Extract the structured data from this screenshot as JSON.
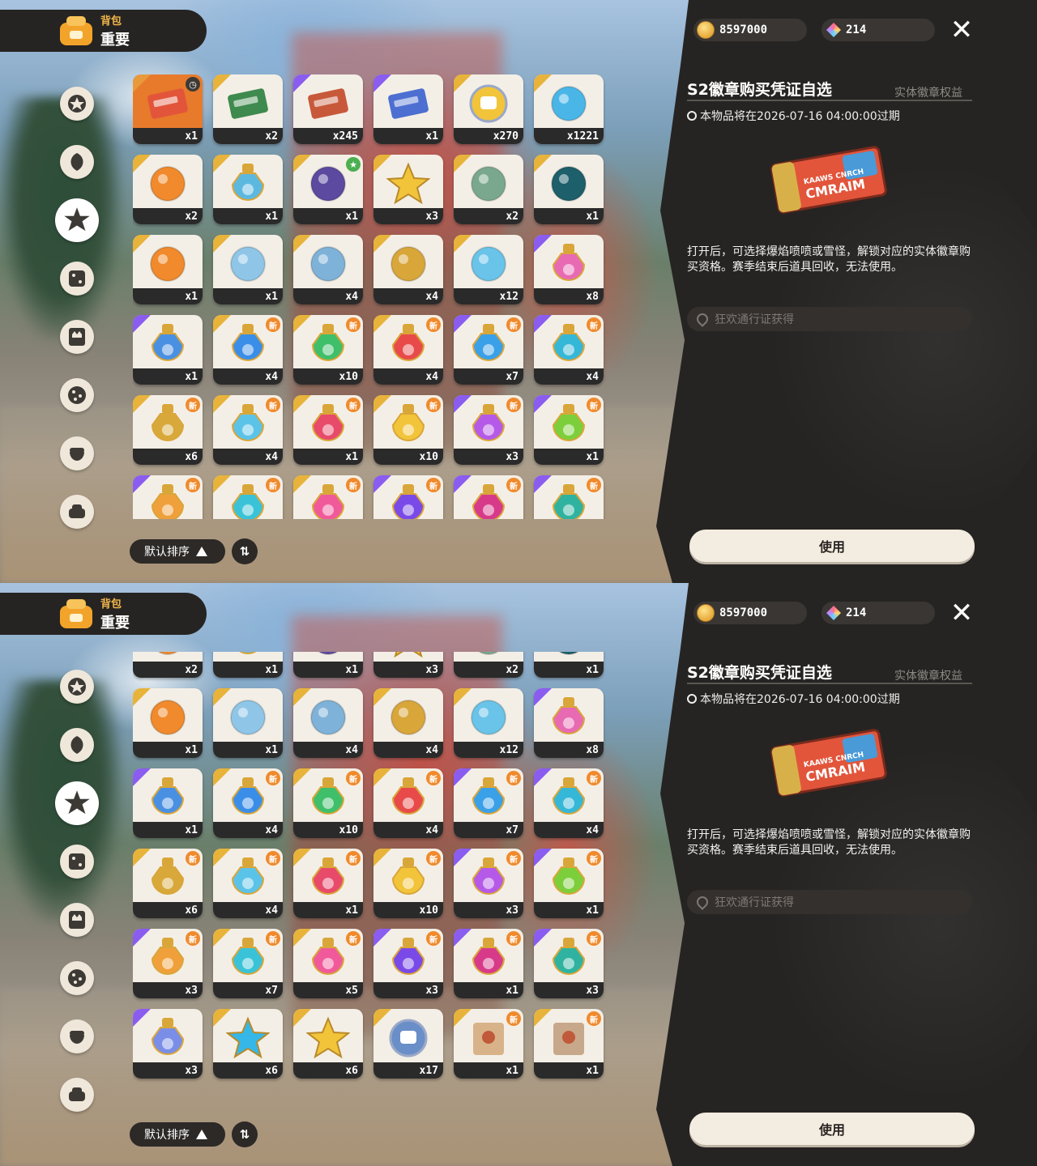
{
  "inventory": {
    "title_small": "背包",
    "title_main": "重要",
    "sort_label": "默认排序",
    "sort_toggle_icon": "⇅"
  },
  "currency": {
    "coins": "8597000",
    "gems": "214"
  },
  "categories": [
    "star-badge-icon",
    "leaf-swirl-icon",
    "starburst-icon",
    "dice-icon",
    "crown-card-icon",
    "dots-ball-icon",
    "acorn-icon",
    "sofa-icon"
  ],
  "detail": {
    "title": "S2徽章购买凭证自选",
    "tag": "实体徽章权益",
    "expire": "本物品将在2026-07-16 04:00:00过期",
    "description": "打开后，可选择爆焰喷喷或雪怪，解锁对应的实体徽章购买资格。赛季结束后道具回收，无法使用。",
    "source": "狂欢通行证获得",
    "use_label": "使用",
    "ticket_text_small": "KAAWS CNRCH",
    "ticket_text_main": "CMRAIM"
  },
  "items": [
    {
      "icon": "ticket-icon",
      "qty": "x1",
      "tier": "#e89a3a",
      "mark": "time",
      "color": "#e2553b"
    },
    {
      "icon": "green-ticket-icon",
      "qty": "x2",
      "tier": "#e8b33a",
      "color": "#3f8a4e"
    },
    {
      "icon": "bunny-ticket-icon",
      "qty": "x245",
      "tier": "#8a5cf0",
      "color": "#c7593a"
    },
    {
      "icon": "card-icon",
      "qty": "x1",
      "tier": "#8a5cf0",
      "color": "#4c6fd1"
    },
    {
      "icon": "camera-coin-icon",
      "qty": "x270",
      "tier": "#e8b33a",
      "color": "#f2c43a"
    },
    {
      "icon": "crystal-icon",
      "qty": "x1221",
      "tier": "#e8b33a",
      "color": "#4ab6e8"
    },
    {
      "icon": "orange-star-emblem-icon",
      "qty": "x2",
      "tier": "#e8b33a",
      "color": "#f08a2c"
    },
    {
      "icon": "blue-swirl-bottle-icon",
      "qty": "x1",
      "tier": "#e8b33a",
      "color": "#5db8e0"
    },
    {
      "icon": "purple-pouch-icon",
      "qty": "x1",
      "tier": "#e8b33a",
      "mark": "green",
      "color": "#5b4aa0"
    },
    {
      "icon": "gold-star-icon",
      "qty": "x3",
      "tier": "#e8b33a",
      "color": "#f2c43a"
    },
    {
      "icon": "crown-icon",
      "qty": "x2",
      "tier": "#e8b33a",
      "color": "#7aa88e"
    },
    {
      "icon": "teal-leaf-icon",
      "qty": "x1",
      "tier": "#e8b33a",
      "color": "#1d5f6a"
    },
    {
      "icon": "fire-flower-icon",
      "qty": "x1",
      "tier": "#e8b33a",
      "color": "#f08a2c"
    },
    {
      "icon": "mirror-icon",
      "qty": "x1",
      "tier": "#e8b33a",
      "color": "#8fc6e8"
    },
    {
      "icon": "shell-icon",
      "qty": "x4",
      "tier": "#e8b33a",
      "color": "#7fb2d8"
    },
    {
      "icon": "key-icon",
      "qty": "x4",
      "tier": "#e8b33a",
      "color": "#d9a63a"
    },
    {
      "icon": "wand-icon",
      "qty": "x12",
      "tier": "#e8b33a",
      "color": "#6ac3e8"
    },
    {
      "icon": "rainbow-bottle-icon",
      "qty": "x8",
      "tier": "#8a5cf0",
      "color": "#e86ab3"
    },
    {
      "icon": "blue-potion-icon",
      "qty": "x1",
      "tier": "#8a5cf0",
      "color": "#4a90e2"
    },
    {
      "icon": "blue-star-potion-icon",
      "qty": "x4",
      "tier": "#e8b33a",
      "new": true,
      "color": "#3a8ee8"
    },
    {
      "icon": "green-potion-icon",
      "qty": "x10",
      "tier": "#e8b33a",
      "new": true,
      "color": "#3fbf6a"
    },
    {
      "icon": "red-potion-icon",
      "qty": "x4",
      "tier": "#e8b33a",
      "new": true,
      "color": "#e84a4a"
    },
    {
      "icon": "blue-drop-potion-icon",
      "qty": "x7",
      "tier": "#8a5cf0",
      "new": true,
      "color": "#3aa0e8"
    },
    {
      "icon": "teal-star-potion-icon",
      "qty": "x4",
      "tier": "#8a5cf0",
      "new": true,
      "color": "#35b7d8"
    },
    {
      "icon": "gold-potion-icon",
      "qty": "x6",
      "tier": "#e8b33a",
      "new": true,
      "color": "#d8a83a"
    },
    {
      "icon": "sky-potion-icon",
      "qty": "x4",
      "tier": "#e8b33a",
      "new": true,
      "color": "#5cc3e8"
    },
    {
      "icon": "heart-potion-icon",
      "qty": "x1",
      "tier": "#e8b33a",
      "new": true,
      "color": "#e84a6a"
    },
    {
      "icon": "yellow-potion-icon",
      "qty": "x10",
      "tier": "#e8b33a",
      "new": true,
      "color": "#f2c43a"
    },
    {
      "icon": "violet-potion-icon",
      "qty": "x3",
      "tier": "#8a5cf0",
      "new": true,
      "color": "#b55ae8"
    },
    {
      "icon": "lime-potion-icon",
      "qty": "x1",
      "tier": "#8a5cf0",
      "new": true,
      "color": "#7ccf3a"
    },
    {
      "icon": "orange-potion-icon",
      "qty": "x3",
      "tier": "#8a5cf0",
      "new": true,
      "color": "#f0a03a"
    },
    {
      "icon": "cyan-potion-icon",
      "qty": "x7",
      "tier": "#e8b33a",
      "new": true,
      "color": "#3ac3d8"
    },
    {
      "icon": "pink-potion-icon",
      "qty": "x5",
      "tier": "#e8b33a",
      "new": true,
      "color": "#f05a9a"
    },
    {
      "icon": "purple-potion-icon",
      "qty": "x3",
      "tier": "#8a5cf0",
      "new": true,
      "color": "#7a4ae8"
    },
    {
      "icon": "magenta-potion-icon",
      "qty": "x1",
      "tier": "#8a5cf0",
      "new": true,
      "color": "#d83a8a"
    },
    {
      "icon": "teal-potion-icon",
      "qty": "x3",
      "tier": "#8a5cf0",
      "new": true,
      "color": "#2fb3a0"
    },
    {
      "icon": "swirl-potion-icon",
      "qty": "x3",
      "tier": "#8a5cf0",
      "color": "#7a8ee8"
    },
    {
      "icon": "blue-c-star-icon",
      "qty": "x6",
      "tier": "#e8b33a",
      "color": "#35b7e8"
    },
    {
      "icon": "gold-c-star-icon",
      "qty": "x6",
      "tier": "#e8b33a",
      "color": "#f2c43a"
    },
    {
      "icon": "robot-coin-icon",
      "qty": "x17",
      "tier": "#e8b33a",
      "color": "#6a8ec8"
    },
    {
      "icon": "fire-scroll-icon",
      "qty": "x1",
      "tier": "#e8b33a",
      "new": true,
      "color": "#d8b38a"
    },
    {
      "icon": "mountain-scroll-icon",
      "qty": "x1",
      "tier": "#e8b33a",
      "new": true,
      "color": "#c8a88a"
    }
  ]
}
